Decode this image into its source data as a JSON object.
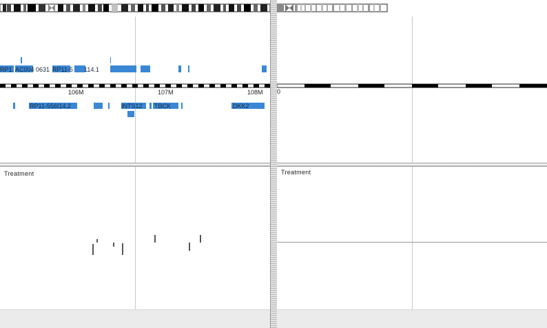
{
  "left_panel": {
    "ruler_labels": [
      "106M",
      "107M",
      "108M"
    ],
    "upper_track_labels": [
      "RP1",
      "AC004",
      "0631",
      "RP11-5",
      "114.1"
    ],
    "lower_track_labels": [
      "RP11-556I14.2",
      "INTS12",
      "TBCK",
      "DKK2"
    ],
    "track_title": "Treatment"
  },
  "right_panel": {
    "ruler_labels": [
      "0"
    ],
    "track_title": "Treatment"
  },
  "colors": {
    "gene": "#3a87d6",
    "signal": "#555555"
  }
}
